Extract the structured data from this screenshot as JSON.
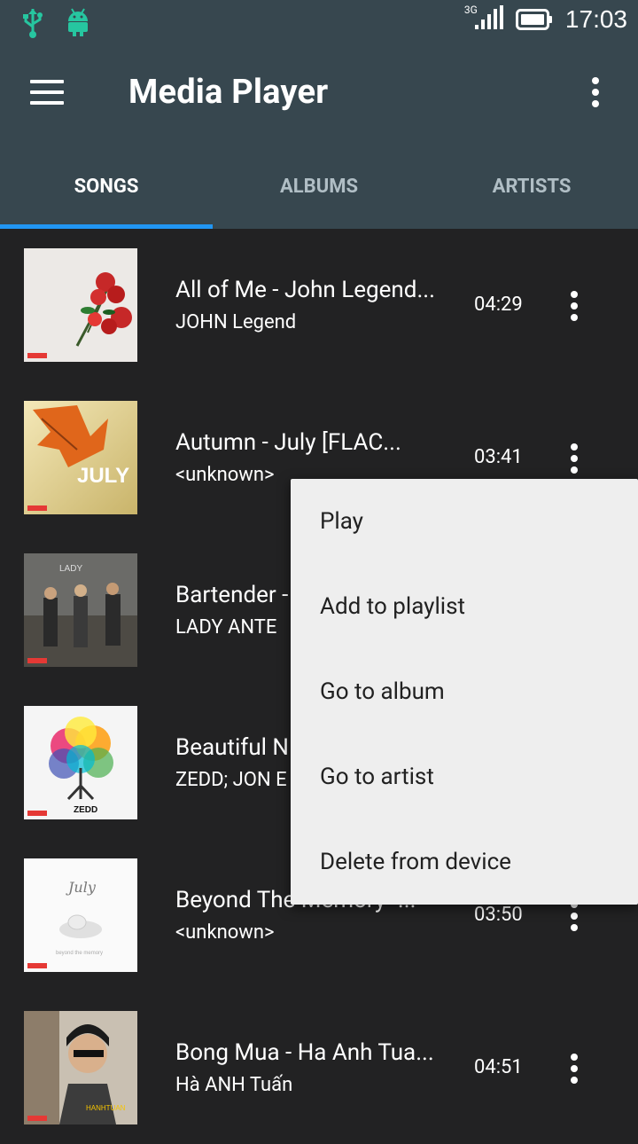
{
  "status": {
    "network": "3G",
    "time": "17:03"
  },
  "header": {
    "title": "Media Player"
  },
  "tabs": [
    {
      "label": "SONGS"
    },
    {
      "label": "ALBUMS"
    },
    {
      "label": "ARTISTS"
    }
  ],
  "songs": [
    {
      "title": "All of Me - John Legend...",
      "artist": "JOHN Legend",
      "duration": "04:29"
    },
    {
      "title": "Autumn - July [FLAC...",
      "artist": "<unknown>",
      "duration": "03:41"
    },
    {
      "title": "Bartender -",
      "artist": "LADY ANTE",
      "duration": ""
    },
    {
      "title": "Beautiful N",
      "artist": "ZEDD; JON E",
      "duration": ""
    },
    {
      "title": "Beyond The Memory -...",
      "artist": "<unknown>",
      "duration": "03:50"
    },
    {
      "title": "Bong Mua - Ha Anh Tua...",
      "artist": "Hà ANH Tuấn",
      "duration": "04:51"
    }
  ],
  "context_menu": {
    "items": [
      {
        "label": "Play"
      },
      {
        "label": "Add to playlist"
      },
      {
        "label": "Go to album"
      },
      {
        "label": "Go to artist"
      },
      {
        "label": "Delete from device"
      }
    ]
  },
  "colors": {
    "appbar": "#37474f",
    "accent": "#2196f3",
    "background": "#222223",
    "status_icon": "#26c6a0"
  }
}
